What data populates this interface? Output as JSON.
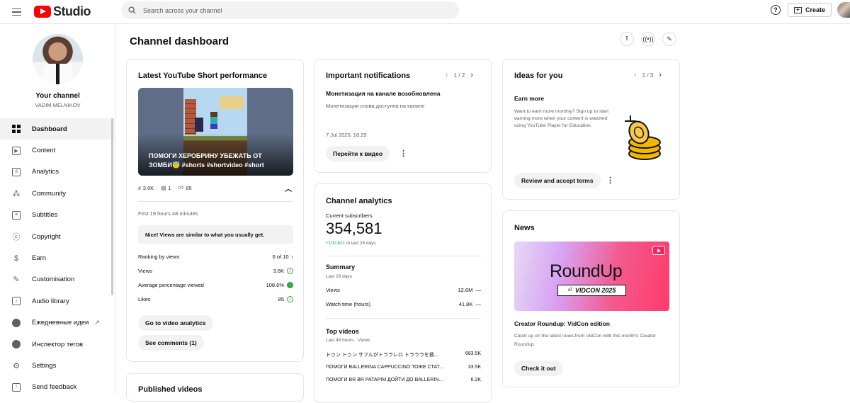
{
  "app": {
    "logo_text": "Studio"
  },
  "search": {
    "placeholder": "Search across your channel"
  },
  "topbar": {
    "help": "?",
    "create_label": "Create"
  },
  "sidebar": {
    "channel_name": "Your channel",
    "channel_handle": "VADIM MELNIKOV",
    "items": [
      {
        "label": "Dashboard",
        "icon": "dashboard-icon",
        "active": true
      },
      {
        "label": "Content",
        "icon": "content-icon"
      },
      {
        "label": "Analytics",
        "icon": "analytics-icon"
      },
      {
        "label": "Community",
        "icon": "community-icon"
      },
      {
        "label": "Subtitles",
        "icon": "subtitles-icon"
      },
      {
        "label": "Copyright",
        "icon": "copyright-icon"
      },
      {
        "label": "Earn",
        "icon": "earn-icon"
      },
      {
        "label": "Customisation",
        "icon": "customisation-icon"
      },
      {
        "label": "Audio library",
        "icon": "audio-library-icon"
      },
      {
        "label": "Ежедневные идеи",
        "icon": "ideas-app-icon"
      },
      {
        "label": "Инспектор тегов",
        "icon": "tag-inspector-icon"
      },
      {
        "label": "Settings",
        "icon": "settings-icon"
      },
      {
        "label": "Send feedback",
        "icon": "feedback-icon"
      }
    ]
  },
  "main": {
    "page_title": "Channel dashboard",
    "short_card": {
      "title": "Latest YouTube Short performance",
      "caption": "ПОМОГИ ХЕРОБРИНУ УБЕЖАТЬ ОТ ЗОМБИ😇 #shorts #shortvideo #short",
      "views_stat": "3.6K",
      "comments_stat": "1",
      "likes_stat": "85",
      "period": "First 19 hours 48 minutes",
      "note": "Nice! Views are similar to what you usually get.",
      "metrics": [
        {
          "label": "Ranking by views",
          "value": "6 of 10"
        },
        {
          "label": "Views",
          "value": "3.6K"
        },
        {
          "label": "Average percentage viewed",
          "value": "108.6%"
        },
        {
          "label": "Likes",
          "value": "85"
        }
      ],
      "analytics_button": "Go to video analytics",
      "comments_button": "See comments (1)"
    },
    "published_card": {
      "title": "Published videos"
    },
    "notifications": {
      "title": "Important notifications",
      "pager": "1 / 2",
      "headline": "Монетизация на канале возобновлена",
      "body": "Монетизация снова доступна на канале",
      "date": "7 Jul 2025, 16:29",
      "button": "Перейти к видео"
    },
    "analytics": {
      "title": "Channel analytics",
      "subs_label": "Current subscribers",
      "subs_value": "354,581",
      "subs_change": "+100,621",
      "subs_change_suffix": "in last 28 days",
      "summary_title": "Summary",
      "summary_period": "Last 28 days",
      "summary": [
        {
          "label": "Views",
          "value": "12.6M",
          "trend": "—"
        },
        {
          "label": "Watch time (hours)",
          "value": "41.8K",
          "trend": "—"
        }
      ],
      "top_title": "Top videos",
      "top_period": "Last 48 hours · Views",
      "top_videos": [
        {
          "title": "トゥン トゥン サフルがトララレロ トラララを救...",
          "views": "683.5K"
        },
        {
          "title": "ПОМОГИ BALLERINA CAPPUCCINO ТОЖЕ СТАТ...",
          "views": "33.5K"
        },
        {
          "title": "ПОМОГИ BR BR PATAPIM ДОЙТИ ДО BALLERIN...",
          "views": "6.2K"
        }
      ]
    },
    "ideas": {
      "title": "Ideas for you",
      "pager": "1 / 3",
      "subtitle": "Earn more",
      "body": "Want to earn more monthly? Sign up to start earning more when your content is watched using YouTube Player for Education.",
      "button": "Review and accept terms"
    },
    "news": {
      "title": "News",
      "image_title": "RoundUp",
      "image_at": "AT",
      "image_event": "VIDCON 2025",
      "headline": "Creator Roundup: VidCon edition",
      "body": "Catch up on the latest news from VidCon with this month's Creator Roundup",
      "button": "Check it out"
    }
  },
  "colors": {
    "brand_red": "#ff0000",
    "positive_green": "#2ba640",
    "accent_gold": "#f2b705"
  }
}
